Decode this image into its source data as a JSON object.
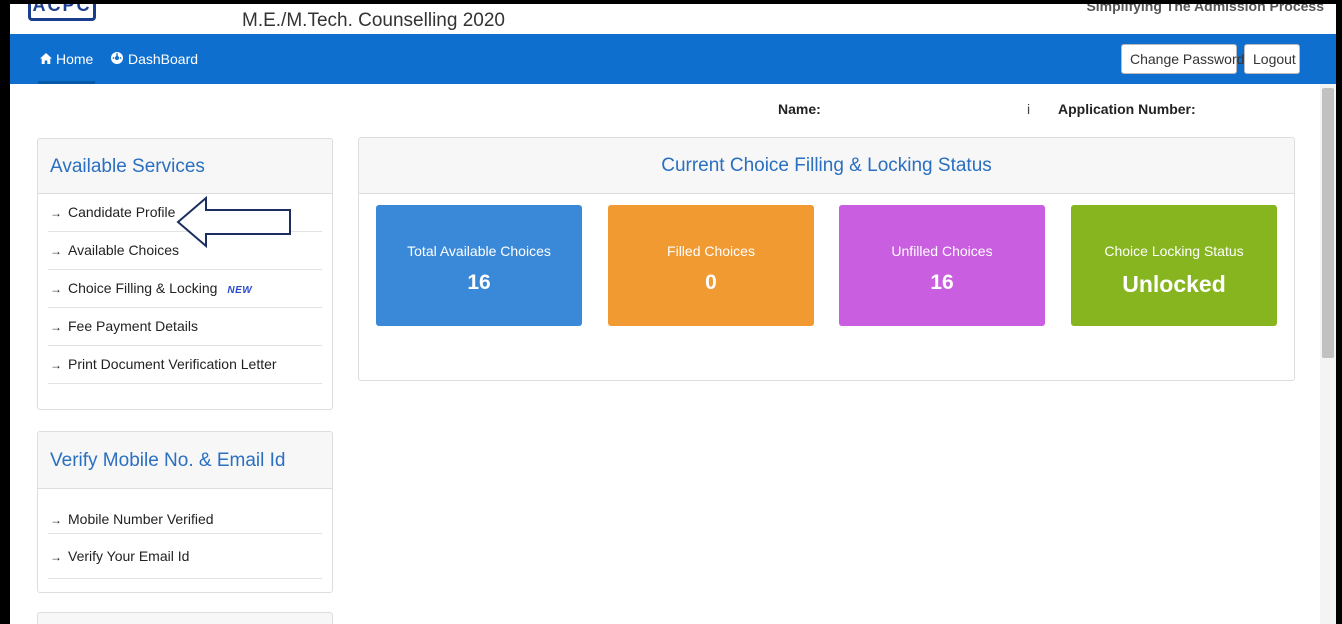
{
  "header": {
    "logo_text": "ACPC",
    "site_title": "M.E./M.Tech. Counselling 2020",
    "tagline": "Simplifying The Admission Process"
  },
  "navbar": {
    "home_label": "Home",
    "dashboard_label": "DashBoard",
    "change_password_label": "Change Password",
    "logout_label": "Logout"
  },
  "candidate": {
    "name_label": "Name:",
    "name_value_mark": "i",
    "application_number_label": "Application Number:"
  },
  "services": {
    "title": "Available Services",
    "items": [
      {
        "label": "Candidate Profile"
      },
      {
        "label": "Available Choices"
      },
      {
        "label": "Choice Filling & Locking",
        "badge": "NEW"
      },
      {
        "label": "Fee Payment Details"
      },
      {
        "label": "Print Document Verification Letter"
      }
    ]
  },
  "verify": {
    "title": "Verify Mobile No. & Email Id",
    "items": [
      {
        "label": "Mobile Number Verified"
      },
      {
        "label": "Verify Your Email Id"
      }
    ]
  },
  "status": {
    "title": "Current Choice Filling & Locking Status",
    "cards": [
      {
        "label": "Total Available Choices",
        "value": "16",
        "color": "#3a89d8"
      },
      {
        "label": "Filled Choices",
        "value": "0",
        "color": "#f19a32"
      },
      {
        "label": "Unfilled Choices",
        "value": "16",
        "color": "#c95ee0"
      },
      {
        "label": "Choice Locking Status",
        "value": "Unlocked",
        "color": "#86b51f"
      }
    ]
  },
  "colors": {
    "navbar": "#0f6fce",
    "panel_title": "#2a6fc0"
  },
  "icons": {
    "home": "home-icon",
    "dashboard": "dashboard-icon",
    "list_arrow": "arrow-right-icon",
    "annotation": "outline-arrow-left-icon"
  }
}
